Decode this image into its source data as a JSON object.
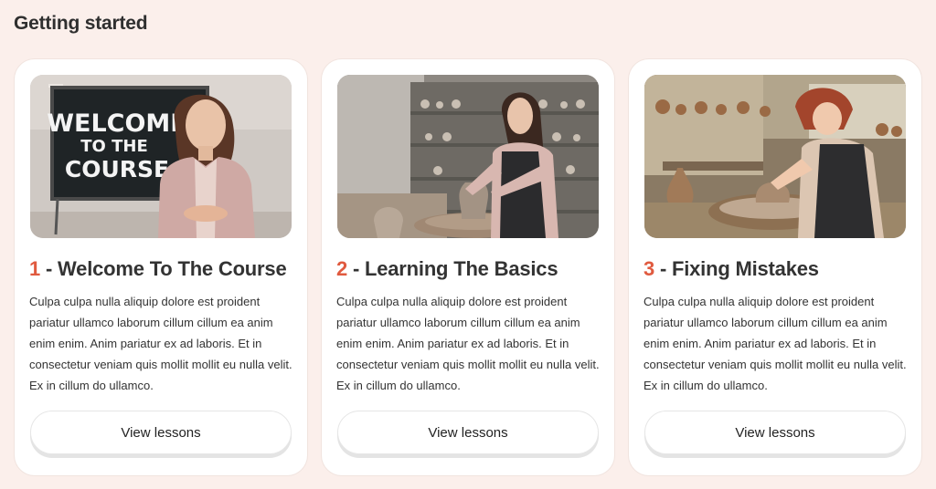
{
  "page": {
    "title": "Getting started"
  },
  "cards": [
    {
      "number": "1",
      "title": " - Welcome To The Course",
      "description": "Culpa culpa nulla aliquip dolore est proident pariatur ullamco laborum cillum cillum ea anim enim enim. Anim pariatur ex ad laboris. Et in consectetur veniam quis mollit mollit eu nulla velit. Ex in cillum do ullamco.",
      "button_label": "View lessons",
      "image": {
        "board_line1": "WELCOME",
        "board_line2": "TO THE",
        "board_line3": "COURSE"
      }
    },
    {
      "number": "2",
      "title": " - Learning The Basics",
      "description": "Culpa culpa nulla aliquip dolore est proident pariatur ullamco laborum cillum cillum ea anim enim enim. Anim pariatur ex ad laboris. Et in consectetur veniam quis mollit mollit eu nulla velit. Ex in cillum do ullamco.",
      "button_label": "View lessons"
    },
    {
      "number": "3",
      "title": " - Fixing Mistakes",
      "description": "Culpa culpa nulla aliquip dolore est proident pariatur ullamco laborum cillum cillum ea anim enim enim. Anim pariatur ex ad laboris. Et in consectetur veniam quis mollit mollit eu nulla velit. Ex in cillum do ullamco.",
      "button_label": "View lessons"
    }
  ],
  "colors": {
    "background": "#fbefeb",
    "accent_number": "#e05a3f",
    "card": "#ffffff"
  }
}
